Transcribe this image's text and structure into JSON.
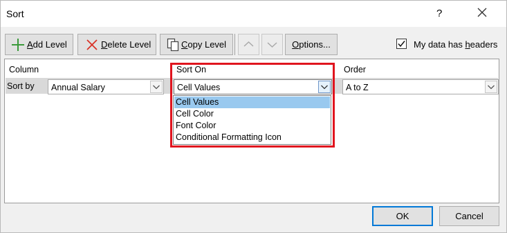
{
  "window": {
    "title": "Sort",
    "help": "?"
  },
  "toolbar": {
    "add_level": {
      "mnemonic": "A",
      "rest": "dd Level"
    },
    "delete_level": {
      "mnemonic": "D",
      "rest": "elete Level"
    },
    "copy_level": {
      "mnemonic": "C",
      "rest": "opy Level"
    },
    "options": {
      "mnemonic": "O",
      "rest": "ptions..."
    },
    "my_data_has_headers": {
      "pre": "My data has ",
      "mnemonic": "h",
      "rest": "eaders",
      "checked": true
    }
  },
  "grid": {
    "headers": {
      "column": "Column",
      "sort_on": "Sort On",
      "order": "Order"
    },
    "row": {
      "label": "Sort by",
      "column_value": "Annual Salary",
      "sort_on_value": "Cell Values",
      "order_value": "A to Z"
    },
    "sort_on_options": [
      "Cell Values",
      "Cell Color",
      "Font Color",
      "Conditional Formatting Icon"
    ],
    "sort_on_selected_index": 0
  },
  "buttons": {
    "ok": "OK",
    "cancel": "Cancel"
  },
  "colors": {
    "highlight": "#e0141e",
    "selection": "#99c9ef",
    "accent": "#0078d7"
  }
}
